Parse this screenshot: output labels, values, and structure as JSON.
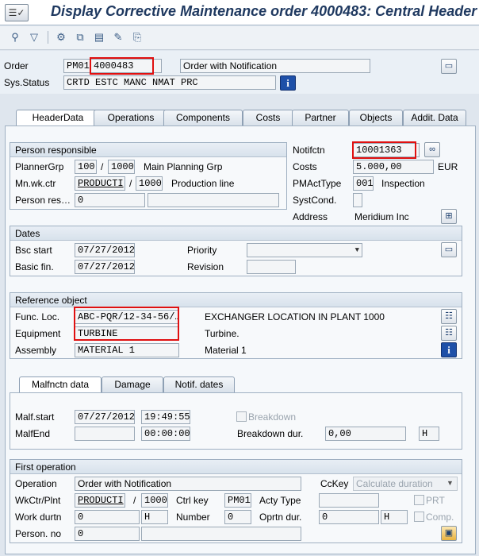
{
  "title": "Display Corrective Maintenance order 4000483: Central Header",
  "title_icon": "menu-icon",
  "toolbar_icons": [
    "tree-icon",
    "filter-icon",
    "hierarchy-icon",
    "copy-icon",
    "document-icon",
    "edit-icon",
    "clipboard-icon"
  ],
  "header": {
    "order_label": "Order",
    "order_type": "PM01",
    "order_number": "4000483",
    "order_desc": "Order with Notification",
    "status_label": "Sys.Status",
    "status_value": "CRTD  ESTC  MANC  NMAT  PRC"
  },
  "tabs": [
    "HeaderData",
    "Operations",
    "Components",
    "Costs",
    "Partner",
    "Objects",
    "Addit. Data"
  ],
  "person_responsible": {
    "title": "Person responsible",
    "planner_label": "PlannerGrp",
    "planner_grp": "100",
    "planner_plant": "1000",
    "planner_text": "Main Planning Grp",
    "workctr_label": "Mn.wk.ctr",
    "workctr": "PRODUCTI",
    "workctr_plant": "1000",
    "workctr_text": "Production line",
    "person_label": "Person res…",
    "person_value": "0"
  },
  "notification": {
    "notifctn_label": "Notifctn",
    "notifctn_value": "10001363",
    "costs_label": "Costs",
    "costs_value": "5.000,00",
    "costs_currency": "EUR",
    "pmact_label": "PMActType",
    "pmact_value": "001",
    "pmact_text": "Inspection",
    "systcond_label": "SystCond.",
    "address_label": "Address",
    "address_value": "Meridium Inc"
  },
  "dates": {
    "title": "Dates",
    "bsc_start_label": "Bsc start",
    "bsc_start": "07/27/2012",
    "basic_fin_label": "Basic fin.",
    "basic_fin": "07/27/2012",
    "priority_label": "Priority",
    "revision_label": "Revision"
  },
  "reference": {
    "title": "Reference object",
    "func_loc_label": "Func. Loc.",
    "func_loc": "ABC-PQR/12-34-56/…",
    "func_loc_text": "EXCHANGER LOCATION IN PLANT 1000",
    "equipment_label": "Equipment",
    "equipment": "TURBINE",
    "equipment_text": "Turbine.",
    "assembly_label": "Assembly",
    "assembly": "MATERIAL 1",
    "assembly_text": "Material 1"
  },
  "malf_tabs": [
    "Malfnctn data",
    "Damage",
    "Notif. dates"
  ],
  "malfunction": {
    "start_label": "Malf.start",
    "start_date": "07/27/2012",
    "start_time": "19:49:55",
    "end_label": "MalfEnd",
    "end_time": "00:00:00",
    "breakdown_label": "Breakdown",
    "duration_label": "Breakdown dur.",
    "duration_value": "0,00",
    "duration_unit": "H"
  },
  "first_operation": {
    "title": "First operation",
    "operation_label": "Operation",
    "operation_value": "Order with Notification",
    "cckey_label": "CcKey",
    "cckey_value": "Calculate duration",
    "wkctr_label": "WkCtr/Plnt",
    "wkctr": "PRODUCTI",
    "wkctr_plant": "1000",
    "ctrl_key_label": "Ctrl key",
    "ctrl_key": "PM01",
    "acty_type_label": "Acty Type",
    "prt_label": "PRT",
    "work_label": "Work durtn",
    "work_value": "0",
    "work_unit": "H",
    "number_label": "Number",
    "number_value": "0",
    "oprtn_dur_label": "Oprtn dur.",
    "oprtn_dur_value": "0",
    "oprtn_dur_unit": "H",
    "comp_label": "Comp.",
    "person_label": "Person. no",
    "person_value": "0"
  }
}
